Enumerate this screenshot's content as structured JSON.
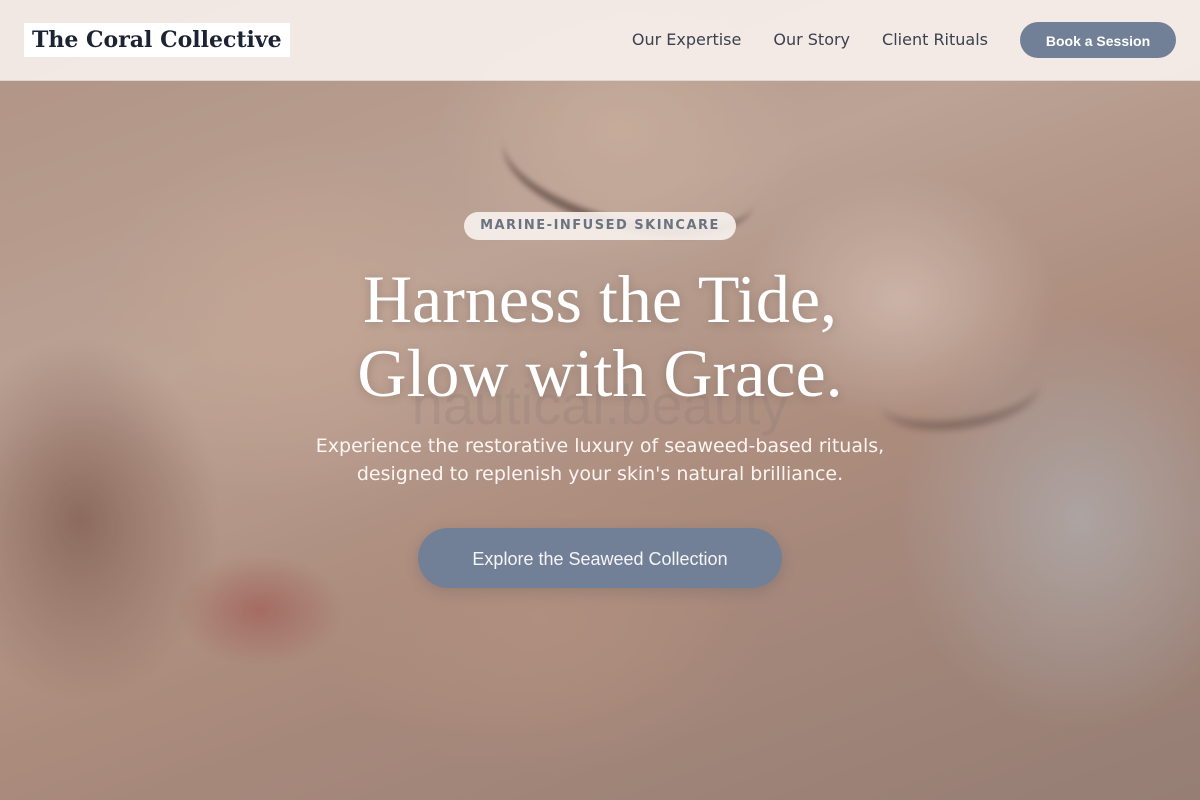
{
  "brand": {
    "name": "The Coral Collective"
  },
  "nav": {
    "links": [
      "Our Expertise",
      "Our Story",
      "Client Rituals"
    ],
    "cta_label": "Book a Session"
  },
  "hero": {
    "tag": "MARINE-INFUSED SKINCARE",
    "headline_line1": "Harness the Tide,",
    "headline_line2": "Glow with Grace.",
    "watermark": "nautical.beauty",
    "subtext_line1": "Experience the restorative luxury of seaweed-based rituals,",
    "subtext_line2": "designed to replenish your skin's natural brilliance.",
    "cta_label": "Explore the Seaweed Collection"
  },
  "colors": {
    "accent": "#718096",
    "logo_text": "#1c2333",
    "nav_text": "#3a4150"
  }
}
